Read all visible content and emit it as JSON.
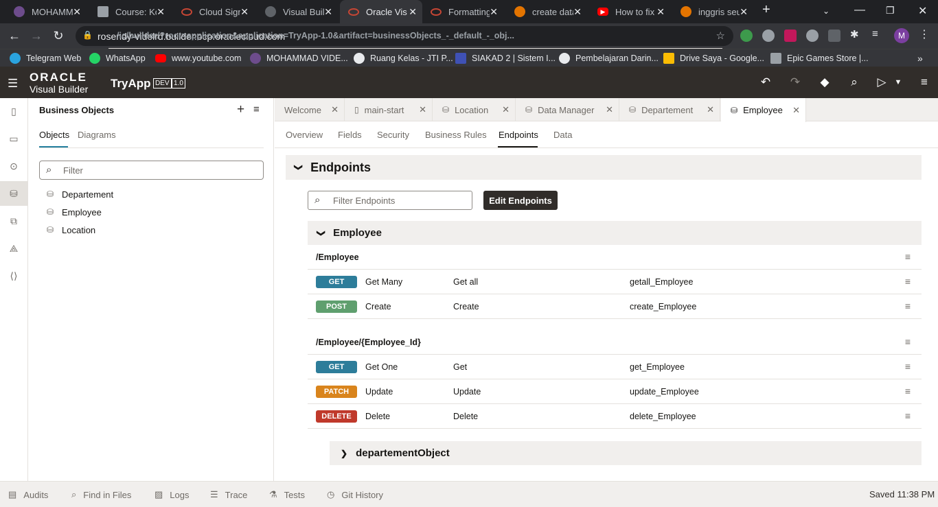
{
  "browser": {
    "tabs": [
      {
        "label": "MOHAMM",
        "color": "#6d4c8c"
      },
      {
        "label": "Course: Ko",
        "color": "#9aa0a6"
      },
      {
        "label": "Cloud Sign",
        "color": "#c74634"
      },
      {
        "label": "Visual Buil",
        "color": "#5f6368"
      },
      {
        "label": "Oracle Visu",
        "color": "#c74634"
      },
      {
        "label": "Formatting",
        "color": "#c74634"
      },
      {
        "label": "create data",
        "color": "#e37400"
      },
      {
        "label": "How to fix",
        "color": "#ff0000"
      },
      {
        "label": "inggris seu",
        "color": "#e37400"
      }
    ],
    "url_host": "rosendy-videlrd.builder.ocp.oraclecloud.com",
    "url_path": "/ic/builder/?root=application&application=TryApp-1.0&artifact=businessObjects_-_default_-_obj...",
    "profile_initial": "M",
    "bookmarks": [
      "Telegram Web",
      "WhatsApp",
      "www.youtube.com",
      "MOHAMMAD VIDE...",
      "Ruang Kelas - JTI P...",
      "SIAKAD 2 | Sistem I...",
      "Pembelajaran Darin...",
      "Drive Saya - Google...",
      "Epic Games Store |..."
    ]
  },
  "header": {
    "logo_line1": "ORACLE",
    "logo_line2": "Visual Builder",
    "app_name": "TryApp",
    "badge_env": "DEV",
    "badge_ver": "1.0"
  },
  "panel": {
    "title": "Business Objects",
    "tabs": [
      "Objects",
      "Diagrams"
    ],
    "filter_placeholder": "Filter",
    "items": [
      "Departement",
      "Employee",
      "Location"
    ]
  },
  "editor_tabs": [
    {
      "label": "Welcome",
      "icon": ""
    },
    {
      "label": "main-start",
      "icon": "page-icon"
    },
    {
      "label": "Location",
      "icon": "database-icon"
    },
    {
      "label": "Data Manager",
      "icon": "database-icon"
    },
    {
      "label": "Departement",
      "icon": "database-icon"
    },
    {
      "label": "Employee",
      "icon": "database-icon"
    }
  ],
  "sub_tabs": [
    "Overview",
    "Fields",
    "Security",
    "Business Rules",
    "Endpoints",
    "Data"
  ],
  "endpoints": {
    "section_title": "Endpoints",
    "filter_placeholder": "Filter Endpoints",
    "edit_button": "Edit Endpoints",
    "group_title": "Employee",
    "collection_path": "/Employee",
    "item_path": "/Employee/{Employee_Id}",
    "rows": [
      {
        "method": "GET",
        "color": "#2d7d9a",
        "name": "Get Many",
        "action": "Get all",
        "id": "getall_Employee"
      },
      {
        "method": "POST",
        "color": "#5f9f6e",
        "name": "Create",
        "action": "Create",
        "id": "create_Employee"
      },
      {
        "method": "GET",
        "color": "#2d7d9a",
        "name": "Get One",
        "action": "Get",
        "id": "get_Employee"
      },
      {
        "method": "PATCH",
        "color": "#d9841c",
        "name": "Update",
        "action": "Update",
        "id": "update_Employee"
      },
      {
        "method": "DELETE",
        "color": "#c0392b",
        "name": "Delete",
        "action": "Delete",
        "id": "delete_Employee"
      }
    ],
    "child_section": "departementObject"
  },
  "footer": {
    "items": [
      "Audits",
      "Find in Files",
      "Logs",
      "Trace",
      "Tests",
      "Git History"
    ],
    "status": "Saved 11:38 PM"
  }
}
